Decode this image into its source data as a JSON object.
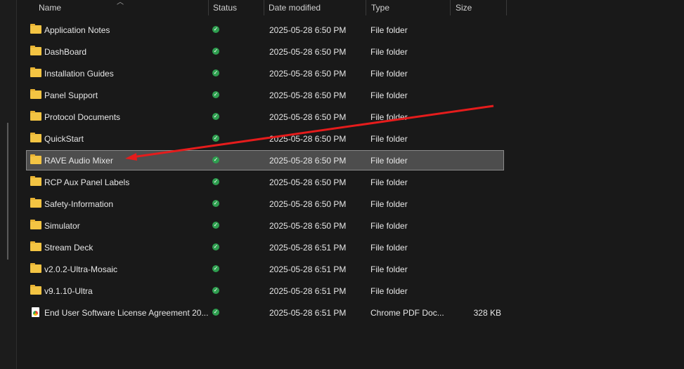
{
  "columns": {
    "name": "Name",
    "status": "Status",
    "date": "Date modified",
    "type": "Type",
    "size": "Size"
  },
  "files": [
    {
      "name": "Application Notes",
      "date": "2025-05-28 6:50 PM",
      "type": "File folder",
      "size": "",
      "icon": "folder"
    },
    {
      "name": "DashBoard",
      "date": "2025-05-28 6:50 PM",
      "type": "File folder",
      "size": "",
      "icon": "folder"
    },
    {
      "name": "Installation Guides",
      "date": "2025-05-28 6:50 PM",
      "type": "File folder",
      "size": "",
      "icon": "folder"
    },
    {
      "name": "Panel Support",
      "date": "2025-05-28 6:50 PM",
      "type": "File folder",
      "size": "",
      "icon": "folder"
    },
    {
      "name": "Protocol Documents",
      "date": "2025-05-28 6:50 PM",
      "type": "File folder",
      "size": "",
      "icon": "folder"
    },
    {
      "name": "QuickStart",
      "date": "2025-05-28 6:50 PM",
      "type": "File folder",
      "size": "",
      "icon": "folder"
    },
    {
      "name": "RAVE Audio Mixer",
      "date": "2025-05-28 6:50 PM",
      "type": "File folder",
      "size": "",
      "icon": "folder",
      "selected": true
    },
    {
      "name": "RCP Aux Panel Labels",
      "date": "2025-05-28 6:50 PM",
      "type": "File folder",
      "size": "",
      "icon": "folder"
    },
    {
      "name": "Safety-Information",
      "date": "2025-05-28 6:50 PM",
      "type": "File folder",
      "size": "",
      "icon": "folder"
    },
    {
      "name": "Simulator",
      "date": "2025-05-28 6:50 PM",
      "type": "File folder",
      "size": "",
      "icon": "folder"
    },
    {
      "name": "Stream Deck",
      "date": "2025-05-28 6:51 PM",
      "type": "File folder",
      "size": "",
      "icon": "folder"
    },
    {
      "name": "v2.0.2-Ultra-Mosaic",
      "date": "2025-05-28 6:51 PM",
      "type": "File folder",
      "size": "",
      "icon": "folder"
    },
    {
      "name": "v9.1.10-Ultra",
      "date": "2025-05-28 6:51 PM",
      "type": "File folder",
      "size": "",
      "icon": "folder"
    },
    {
      "name": "End User Software License Agreement 20...",
      "date": "2025-05-28 6:51 PM",
      "type": "Chrome PDF Doc...",
      "size": "328 KB",
      "icon": "pdf"
    }
  ],
  "annotation_color": "#e51c1c"
}
